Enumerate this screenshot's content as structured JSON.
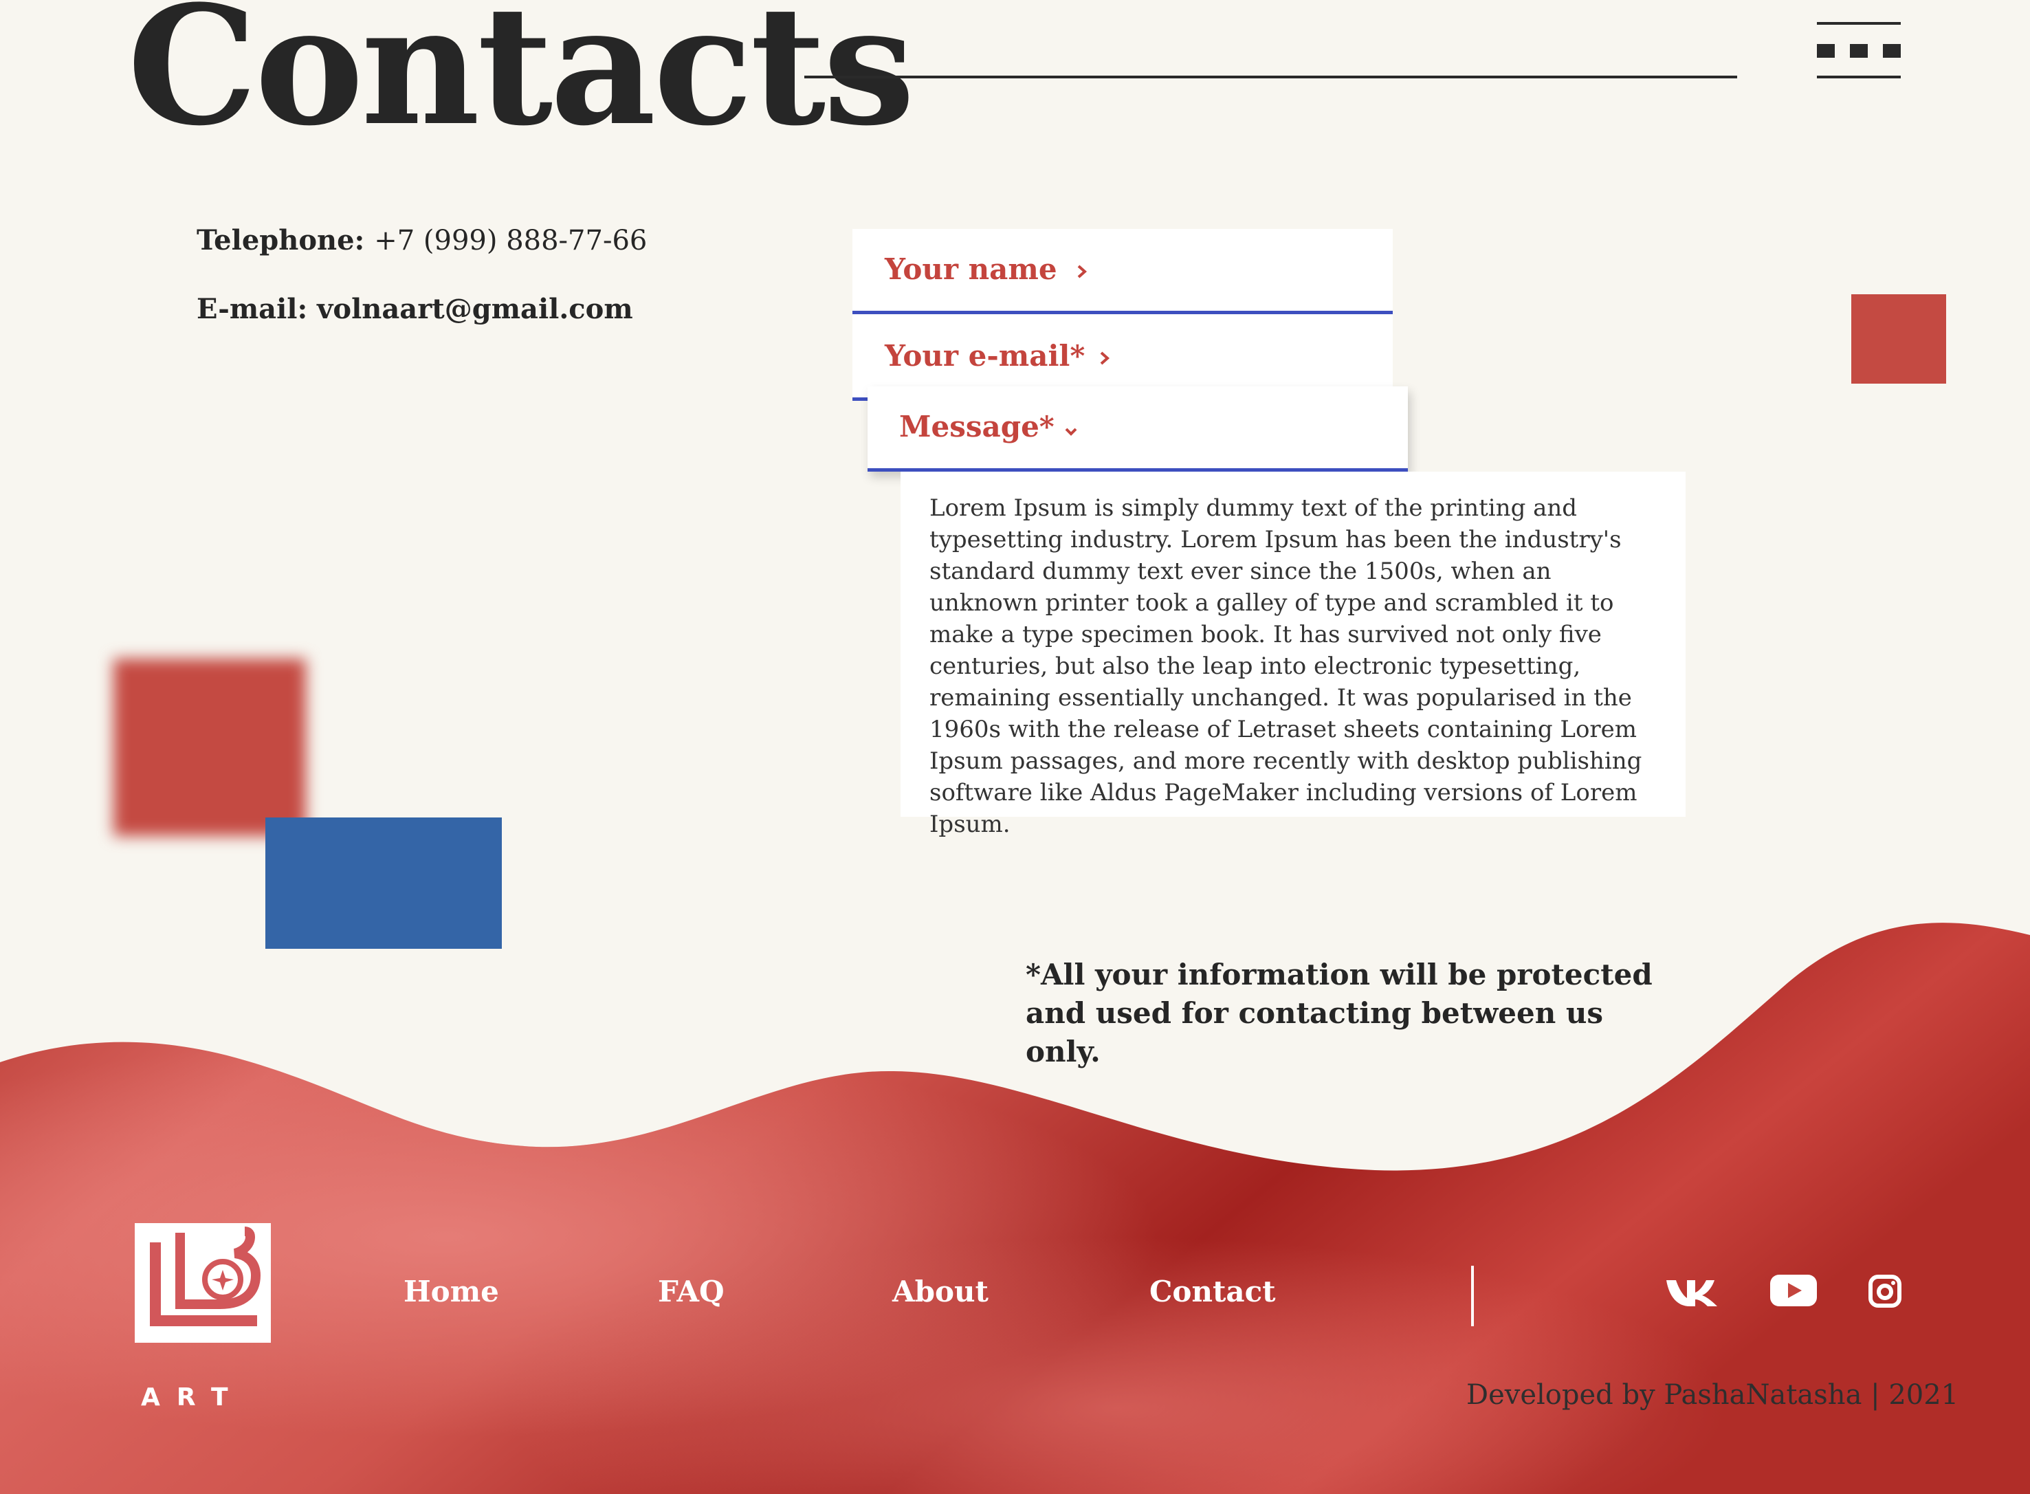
{
  "page": {
    "title": "Contacts"
  },
  "contacts": {
    "phone_label": "Telephone:",
    "phone_value": "+7 (999) 888-77-66",
    "email_label": "E-mail:",
    "email_value": "volnaart@gmail.com"
  },
  "form": {
    "name_label": "Your name",
    "name_icon": "chevron-right",
    "email_label": "Your e-mail*",
    "email_icon": "chevron-right",
    "message_label": "Message*",
    "message_icon": "chevron-down",
    "message_text": "Lorem Ipsum is simply dummy text of the printing and typesetting industry. Lorem Ipsum has been the industry's standard dummy text ever since the 1500s, when an unknown printer took a galley of type and scrambled it to make a type specimen book. It has survived not only five centuries, but also the leap into electronic typesetting, remaining essentially unchanged. It was popularised in the 1960s with the release of Letraset sheets containing Lorem Ipsum passages, and more recently with desktop publishing software like Aldus PageMaker including versions of Lorem Ipsum.",
    "privacy_note": "*All your information will be protected and used for contacting between us only."
  },
  "footer": {
    "logo_text": "ART",
    "nav": [
      {
        "label": "Home"
      },
      {
        "label": "FAQ"
      },
      {
        "label": "About"
      },
      {
        "label": "Contact"
      }
    ],
    "social": [
      {
        "icon": "vk-icon"
      },
      {
        "icon": "youtube-icon"
      },
      {
        "icon": "instagram-icon"
      }
    ],
    "credit": "Developed by PashaNatasha | 2021"
  },
  "colors": {
    "accent_red": "#c4443d",
    "accent_blue": "#3465a7",
    "field_underline": "#3d4fbf",
    "background": "#f8f6f0",
    "text_dark": "#262626"
  }
}
